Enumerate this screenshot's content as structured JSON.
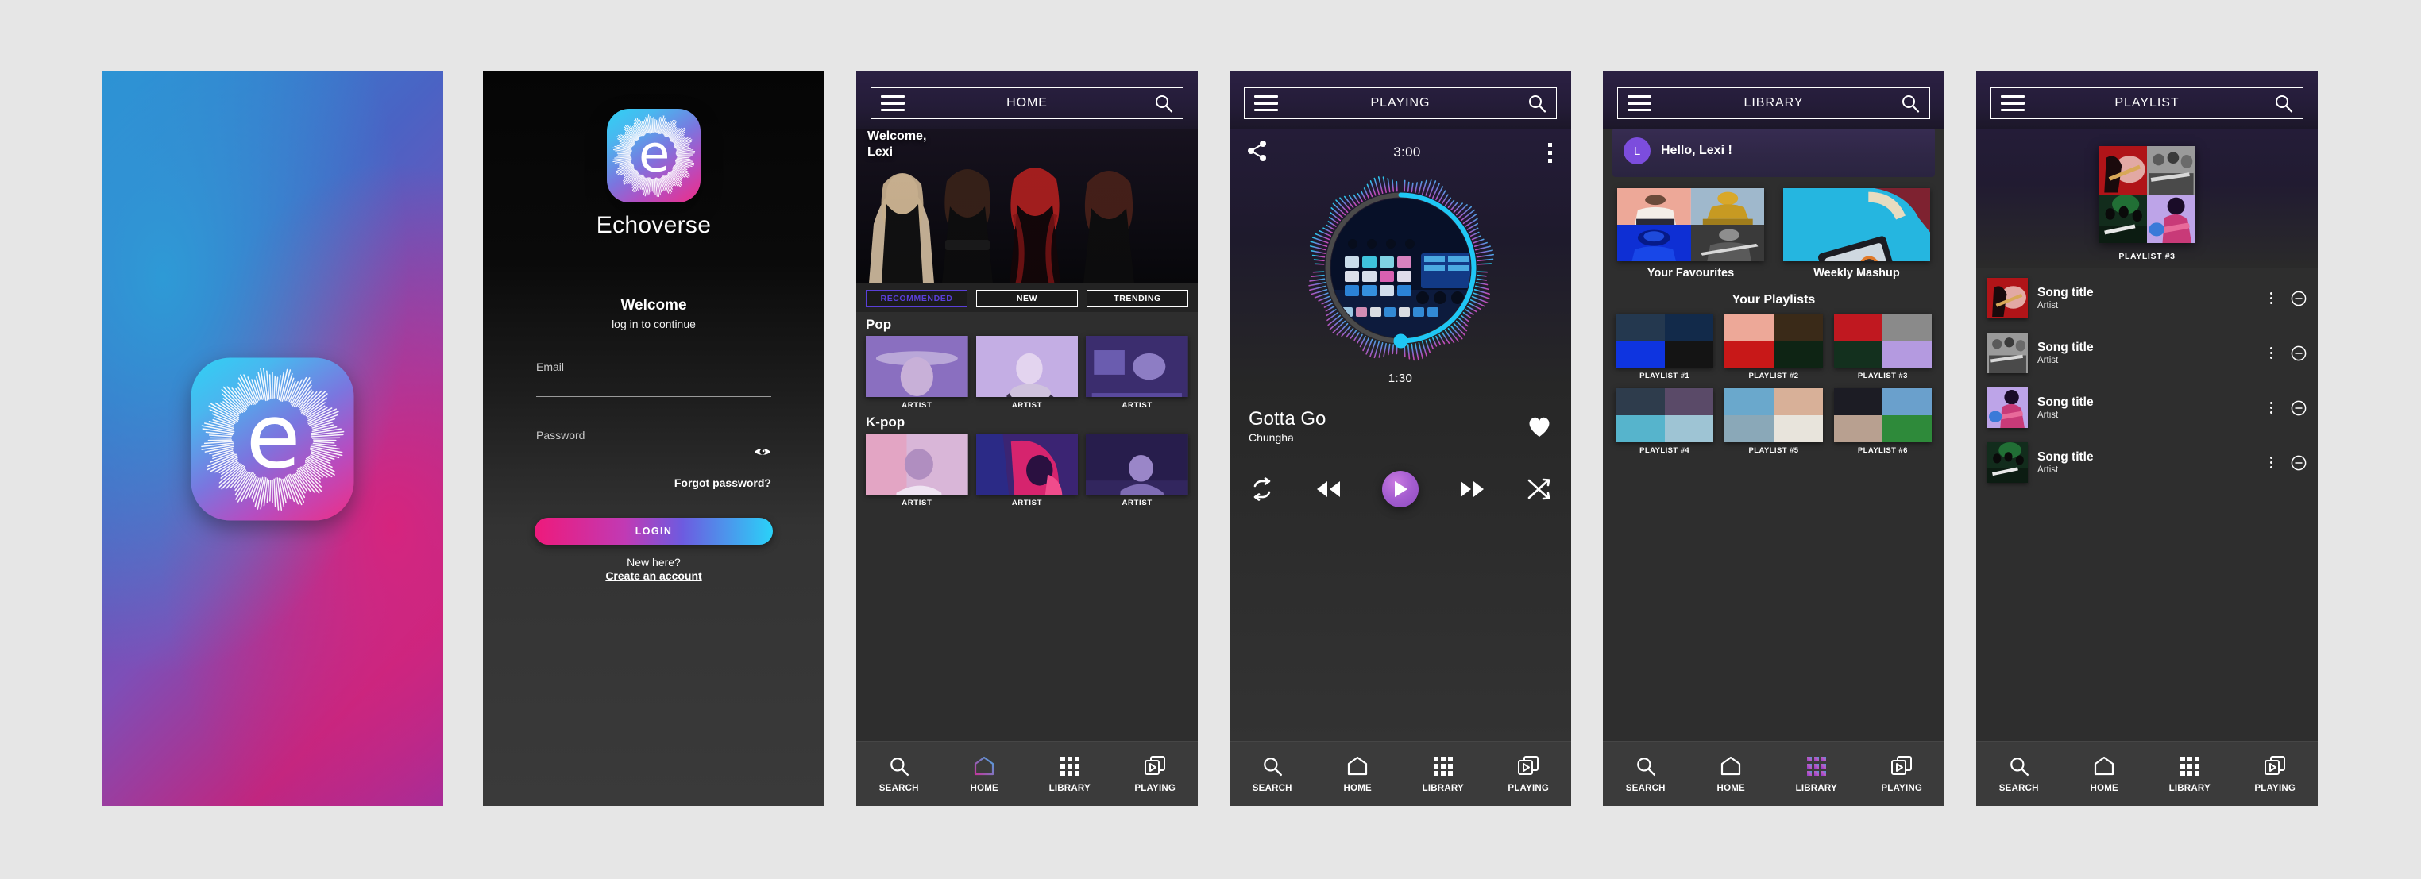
{
  "app": {
    "name": "Echoverse"
  },
  "screens": {
    "splash": {
      "name": "splash-screen",
      "logo_letter": "e"
    },
    "login": {
      "brand": "Echoverse",
      "logo_letter": "e",
      "welcome_title": "Welcome",
      "welcome_sub": "log in to continue",
      "email_label": "Email",
      "email_value": "",
      "password_label": "Password",
      "password_value": "",
      "show_password_icon": "eye-icon",
      "forgot_link": "Forgot password?",
      "login_button": "LOGIN",
      "new_here": "New here?",
      "create_account": "Create an account"
    },
    "home": {
      "title": "HOME",
      "menu_icon": "hamburger-icon",
      "search_icon": "search-icon",
      "welcome_line1": "Welcome,",
      "welcome_line2": "Lexi",
      "chips": [
        {
          "label": "RECOMMENDED",
          "active": true
        },
        {
          "label": "NEW",
          "active": false
        },
        {
          "label": "TRENDING",
          "active": false
        }
      ],
      "genres": [
        {
          "title": "Pop",
          "cards": [
            {
              "label": "ARTIST"
            },
            {
              "label": "ARTIST"
            },
            {
              "label": "ARTIST"
            }
          ]
        },
        {
          "title": "K-pop",
          "cards": [
            {
              "label": "ARTIST"
            },
            {
              "label": "ARTIST"
            },
            {
              "label": "ARTIST"
            }
          ]
        }
      ]
    },
    "playing": {
      "title": "PLAYING",
      "share_icon": "share-icon",
      "more_icon": "kebab-menu-icon",
      "duration": "3:00",
      "elapsed": "1:30",
      "progress_percent": 50,
      "song_title": "Gotta Go",
      "artist": "Chungha",
      "favourite_icon": "heart-icon",
      "controls": {
        "repeat": "repeat-icon",
        "previous": "rewind-icon",
        "play": "play-icon",
        "next": "fast-forward-icon",
        "shuffle": "shuffle-icon"
      }
    },
    "library": {
      "title": "LIBRARY",
      "avatar_initial": "L",
      "greeting": "Hello, Lexi !",
      "features": [
        {
          "label": "Your Favourites"
        },
        {
          "label": "Weekly Mashup"
        }
      ],
      "playlists_heading": "Your Playlists",
      "playlists": [
        {
          "label": "PLAYLIST #1"
        },
        {
          "label": "PLAYLIST #2"
        },
        {
          "label": "PLAYLIST #3"
        },
        {
          "label": "PLAYLIST #4"
        },
        {
          "label": "PLAYLIST #5"
        },
        {
          "label": "PLAYLIST #6"
        }
      ]
    },
    "playlist": {
      "title": "PLAYLIST",
      "cover_label": "PLAYLIST #3",
      "songs": [
        {
          "title": "Song title",
          "artist": "Artist"
        },
        {
          "title": "Song title",
          "artist": "Artist"
        },
        {
          "title": "Song title",
          "artist": "Artist"
        },
        {
          "title": "Song title",
          "artist": "Artist"
        }
      ],
      "row_more_icon": "kebab-menu-icon",
      "row_remove_icon": "remove-circle-icon"
    }
  },
  "bottom_nav": {
    "items": [
      {
        "label": "SEARCH",
        "icon": "search-icon"
      },
      {
        "label": "HOME",
        "icon": "home-icon"
      },
      {
        "label": "LIBRARY",
        "icon": "grid-icon"
      },
      {
        "label": "PLAYING",
        "icon": "play-cards-icon"
      }
    ],
    "active_per_screen": {
      "home": "HOME",
      "playing": "PLAYING",
      "library": "LIBRARY",
      "playlist": ""
    }
  },
  "colors": {
    "canvas": "#e6e6e6",
    "accent_cyan": "#2ad2f8",
    "accent_magenta": "#ee1a7b",
    "accent_violet": "#5a3fd8",
    "avatar_purple": "#7c4ddd",
    "header_purple": "#2b2043",
    "surface_dark": "#2e2e2e",
    "nav_bar": "#3b3b3b"
  }
}
